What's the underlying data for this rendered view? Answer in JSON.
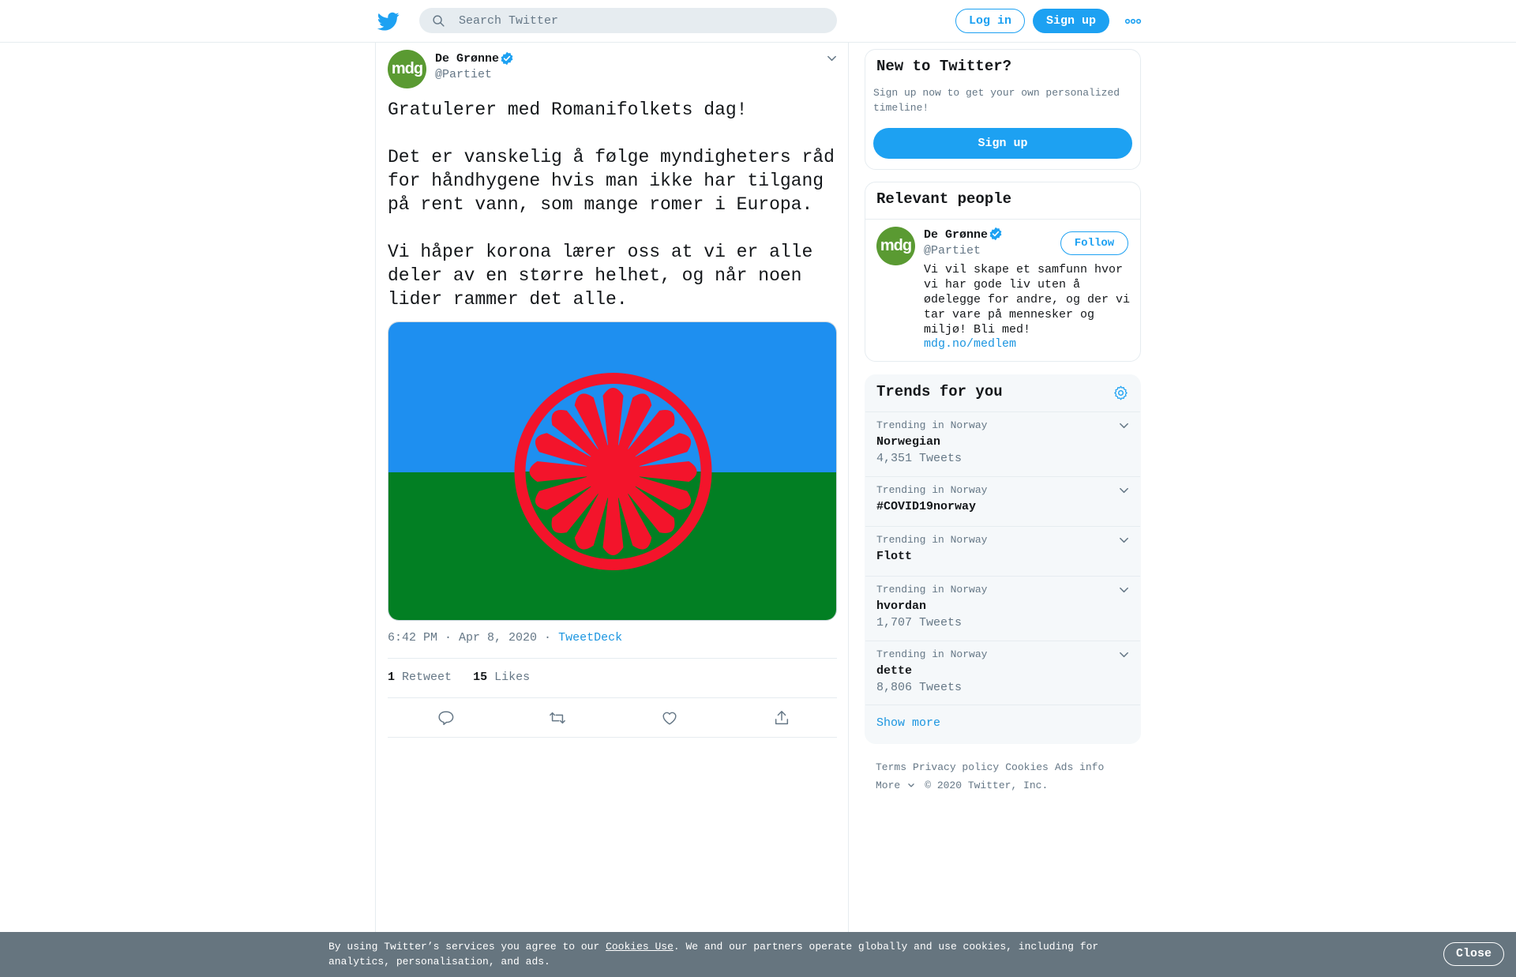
{
  "header": {
    "search_placeholder": "Search Twitter",
    "login_label": "Log in",
    "signup_label": "Sign up"
  },
  "tweet": {
    "author_name": "De Grønne",
    "author_handle": "@Partiet",
    "avatar_text": "mdg",
    "text": "Gratulerer med Romanifolkets dag!\n\nDet er vanskelig å følge myndigheters råd for håndhygene hvis man ikke har tilgang på rent vann, som mange romer i Europa.\n\nVi håper korona lærer oss at vi er alle deler av en større helhet, og når noen lider rammer det alle.",
    "time": "6:42 PM · Apr 8, 2020",
    "separator": "·",
    "source": "TweetDeck",
    "retweet_count": "1",
    "retweet_label": "Retweet",
    "like_count": "15",
    "like_label": "Likes"
  },
  "new_to_twitter": {
    "title": "New to Twitter?",
    "description": "Sign up now to get your own personalized timeline!",
    "signup_label": "Sign up"
  },
  "relevant_people": {
    "title": "Relevant people",
    "name": "De Grønne",
    "handle": "@Partiet",
    "avatar_text": "mdg",
    "follow_label": "Follow",
    "bio": "Vi vil skape et samfunn hvor vi har gode liv uten å ødelegge for andre, og der vi tar vare på mennesker og miljø! Bli med!",
    "link": "mdg.no/medlem"
  },
  "trends": {
    "title": "Trends for you",
    "items": [
      {
        "context": "Trending in Norway",
        "name": "Norwegian",
        "count": "4,351 Tweets"
      },
      {
        "context": "Trending in Norway",
        "name": "#COVID19norway",
        "count": ""
      },
      {
        "context": "Trending in Norway",
        "name": "Flott",
        "count": ""
      },
      {
        "context": "Trending in Norway",
        "name": "hvordan",
        "count": "1,707 Tweets"
      },
      {
        "context": "Trending in Norway",
        "name": "dette",
        "count": "8,806 Tweets"
      }
    ],
    "show_more": "Show more"
  },
  "footer": {
    "links": [
      "Terms",
      "Privacy policy",
      "Cookies",
      "Ads info"
    ],
    "more": "More",
    "copyright": "© 2020 Twitter, Inc."
  },
  "cookie_banner": {
    "text_before": "By using Twitter’s services you agree to our ",
    "link": "Cookies Use",
    "text_after": ". We and our partners operate globally and use cookies, including for analytics, personalisation, and ads.",
    "close_label": "Close"
  },
  "colors": {
    "brand": "#1da1f2",
    "flag_blue": "#1e8ff0",
    "flag_green": "#027f23",
    "flag_wheel": "#f3142b",
    "avatar_green": "#5a9a32"
  },
  "icons": [
    "twitter-bird-icon",
    "search-icon",
    "more-dots-icon",
    "verified-badge-icon",
    "chevron-down-icon",
    "reply-icon",
    "retweet-icon",
    "like-icon",
    "share-icon",
    "gear-icon"
  ]
}
